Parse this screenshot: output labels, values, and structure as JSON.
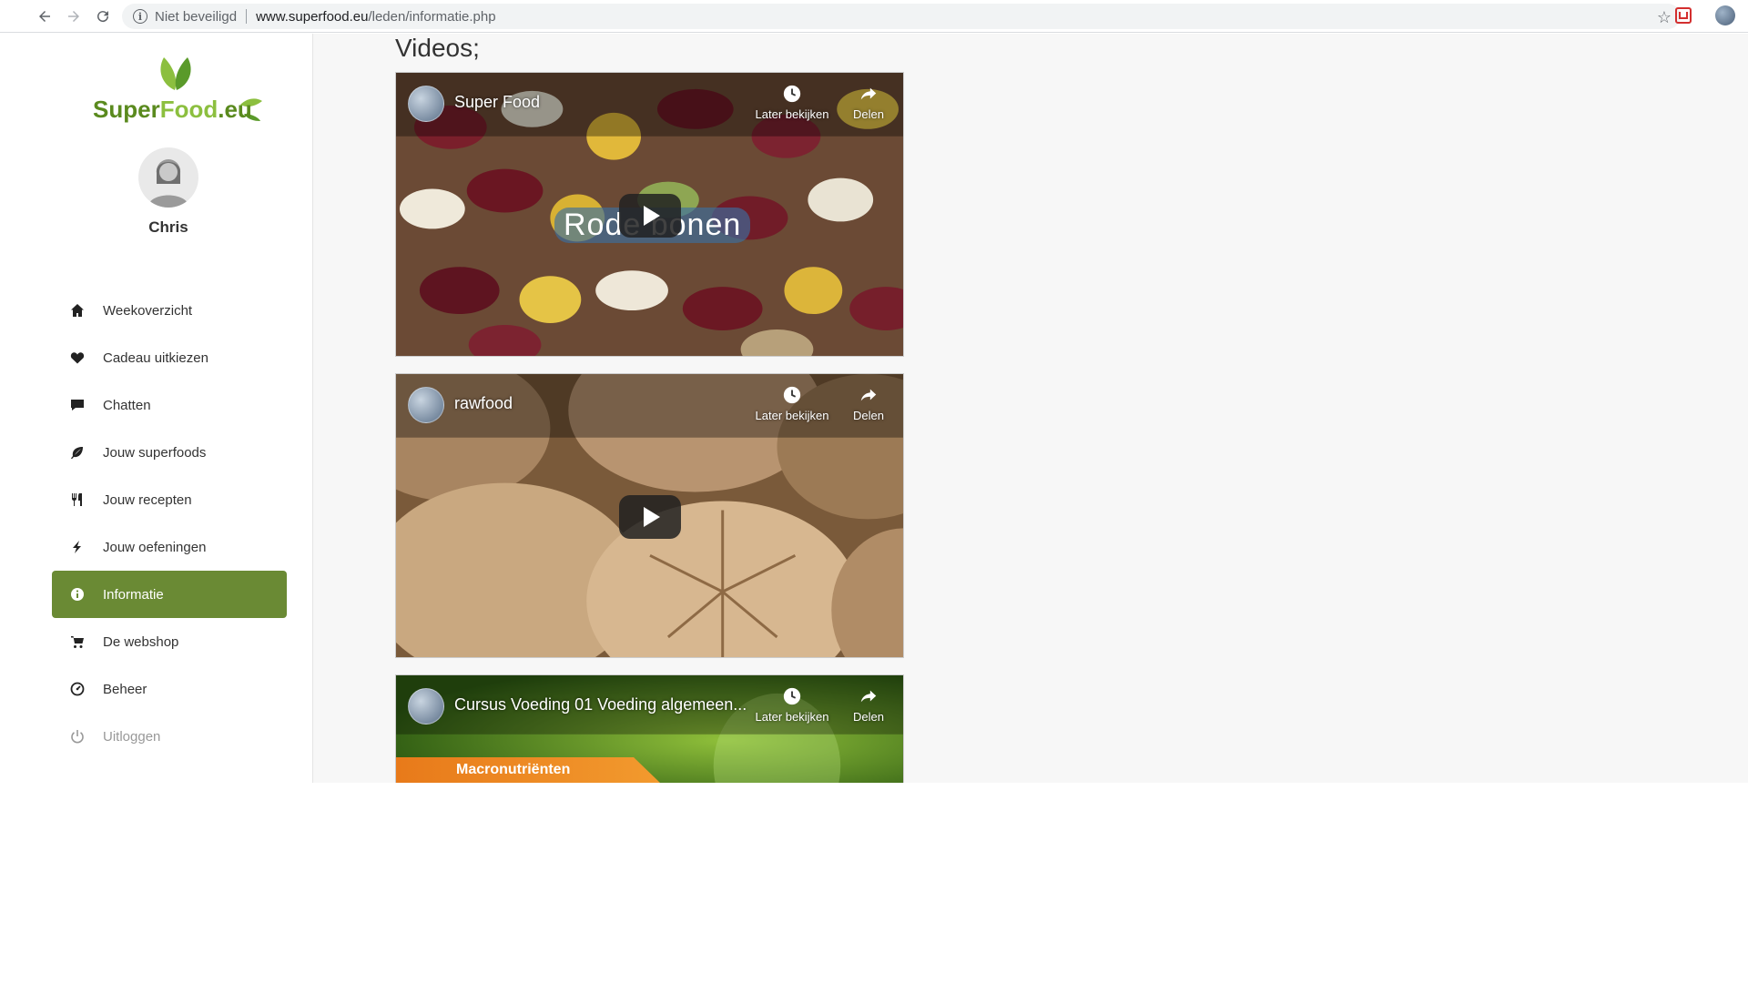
{
  "browser": {
    "security_label": "Niet beveiligd",
    "url_host": "www.superfood.eu",
    "url_path": "/leden/informatie.php"
  },
  "sidebar": {
    "logo_text": "SuperFood.eu",
    "user_name": "Chris",
    "items": [
      {
        "label": "Weekoverzicht",
        "icon": "home-icon"
      },
      {
        "label": "Cadeau uitkiezen",
        "icon": "heart-icon"
      },
      {
        "label": "Chatten",
        "icon": "chat-icon"
      },
      {
        "label": "Jouw superfoods",
        "icon": "leaf-icon"
      },
      {
        "label": "Jouw recepten",
        "icon": "cutlery-icon"
      },
      {
        "label": "Jouw oefeningen",
        "icon": "bolt-icon"
      },
      {
        "label": "Informatie",
        "icon": "info-icon",
        "active": true
      },
      {
        "label": "De webshop",
        "icon": "cart-icon"
      },
      {
        "label": "Beheer",
        "icon": "dashboard-icon"
      },
      {
        "label": "Uitloggen",
        "icon": "power-icon"
      }
    ]
  },
  "main": {
    "title": "Videos;",
    "videos": [
      {
        "title": "Super Food",
        "caption": "Rode bonen",
        "later": "Later bekijken",
        "share": "Delen"
      },
      {
        "title": "rawfood",
        "later": "Later bekijken",
        "share": "Delen"
      },
      {
        "title": "Cursus Voeding 01 Voeding algemeen...",
        "banner": "Macronutriënten",
        "later": "Later bekijken",
        "share": "Delen"
      }
    ]
  },
  "colors": {
    "accent": "#6a8a34",
    "text": "#333333",
    "muted": "#999999"
  }
}
